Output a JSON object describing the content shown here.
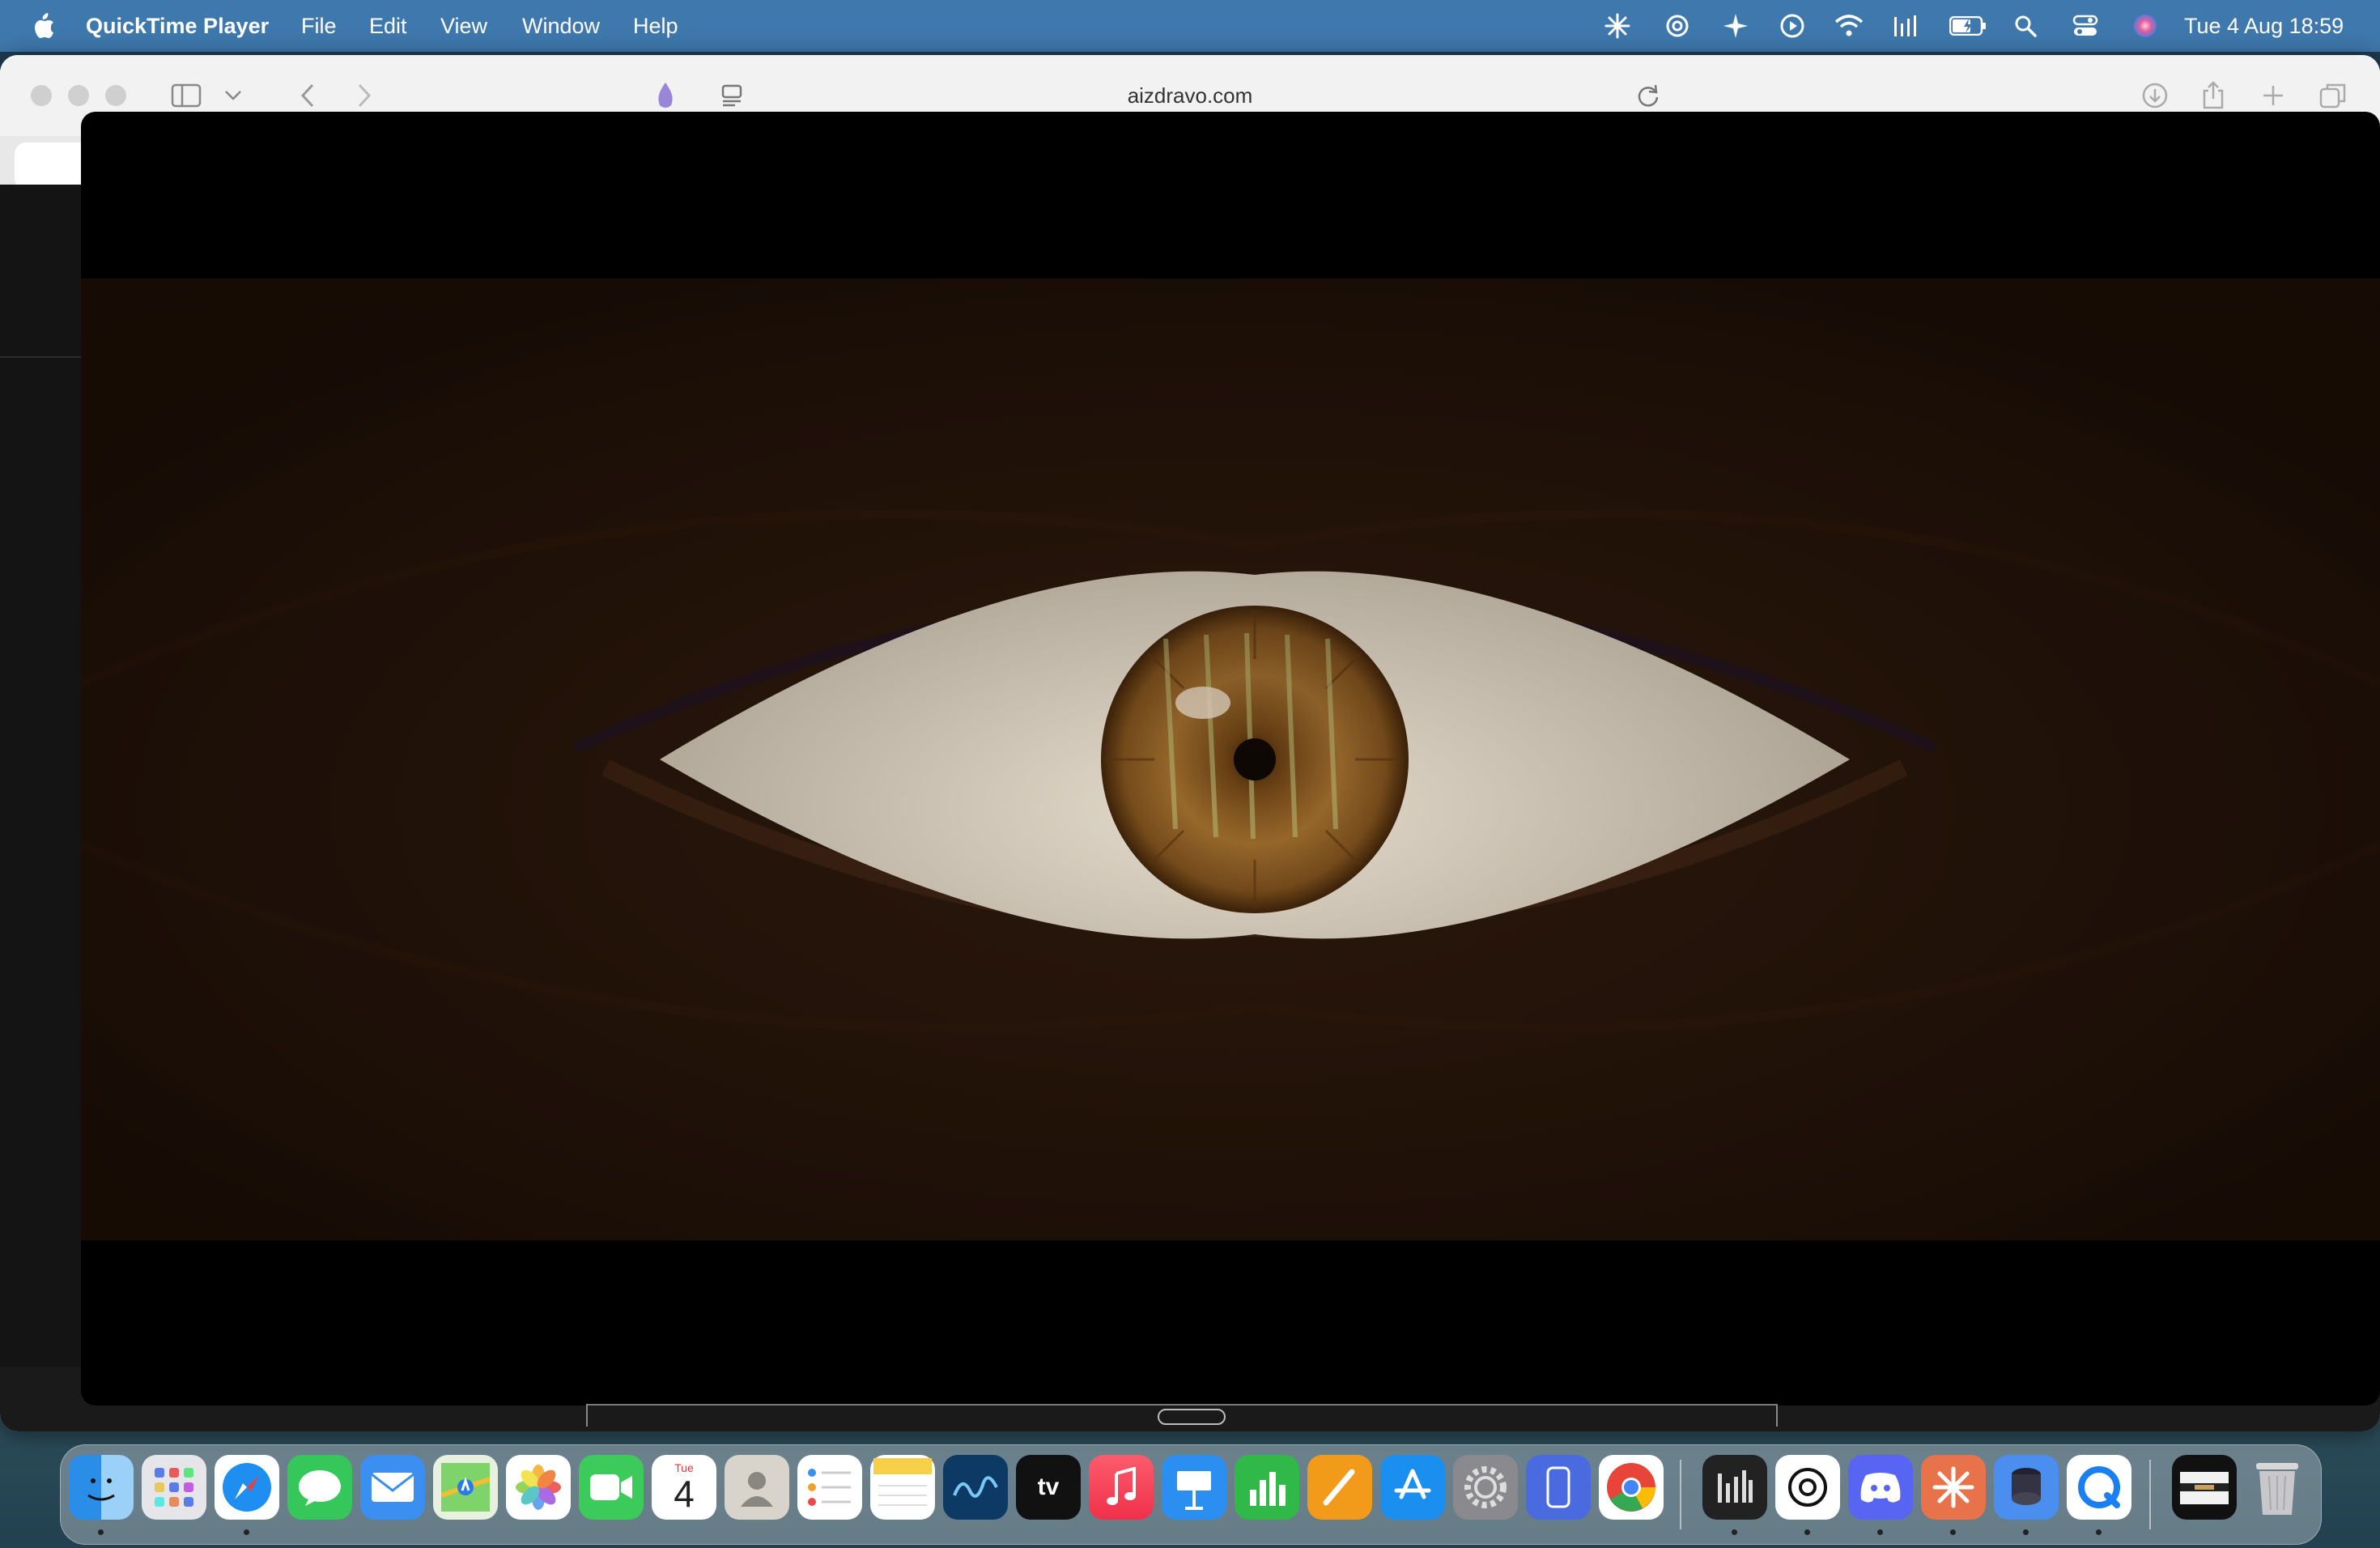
{
  "menubar": {
    "app_name": "QuickTime Player",
    "menus": [
      "File",
      "Edit",
      "View",
      "Window",
      "Help"
    ],
    "status_icons": [
      "claude-icon",
      "openai-icon",
      "sparkle-icon",
      "play-circle-icon",
      "wifi-icon",
      "audio-bars-icon",
      "battery-icon",
      "search-icon",
      "control-center-icon",
      "siri-icon"
    ],
    "datetime": "Tue 4 Aug  18:59"
  },
  "browser": {
    "url": "aizdravo.com"
  },
  "video": {
    "description_colors": {
      "background": "#221309",
      "sclera": "#e4dccc",
      "iris": "#8a5a24"
    }
  },
  "dock": {
    "calendar_month": "Tue",
    "calendar_day": "4",
    "appletv_label": "tv",
    "apps": [
      "finder",
      "launchpad",
      "safari",
      "messages",
      "mail",
      "maps",
      "photos",
      "facetime",
      "calendar",
      "contacts",
      "reminders",
      "notes",
      "freeform",
      "apple-tv",
      "music",
      "keynote",
      "numbers",
      "pages",
      "app-store",
      "system-settings",
      "iphone-mirroring",
      "chrome",
      "audio-app",
      "chatgpt",
      "discord",
      "claude",
      "storage-app",
      "quicktime",
      "folder",
      "trash"
    ]
  }
}
